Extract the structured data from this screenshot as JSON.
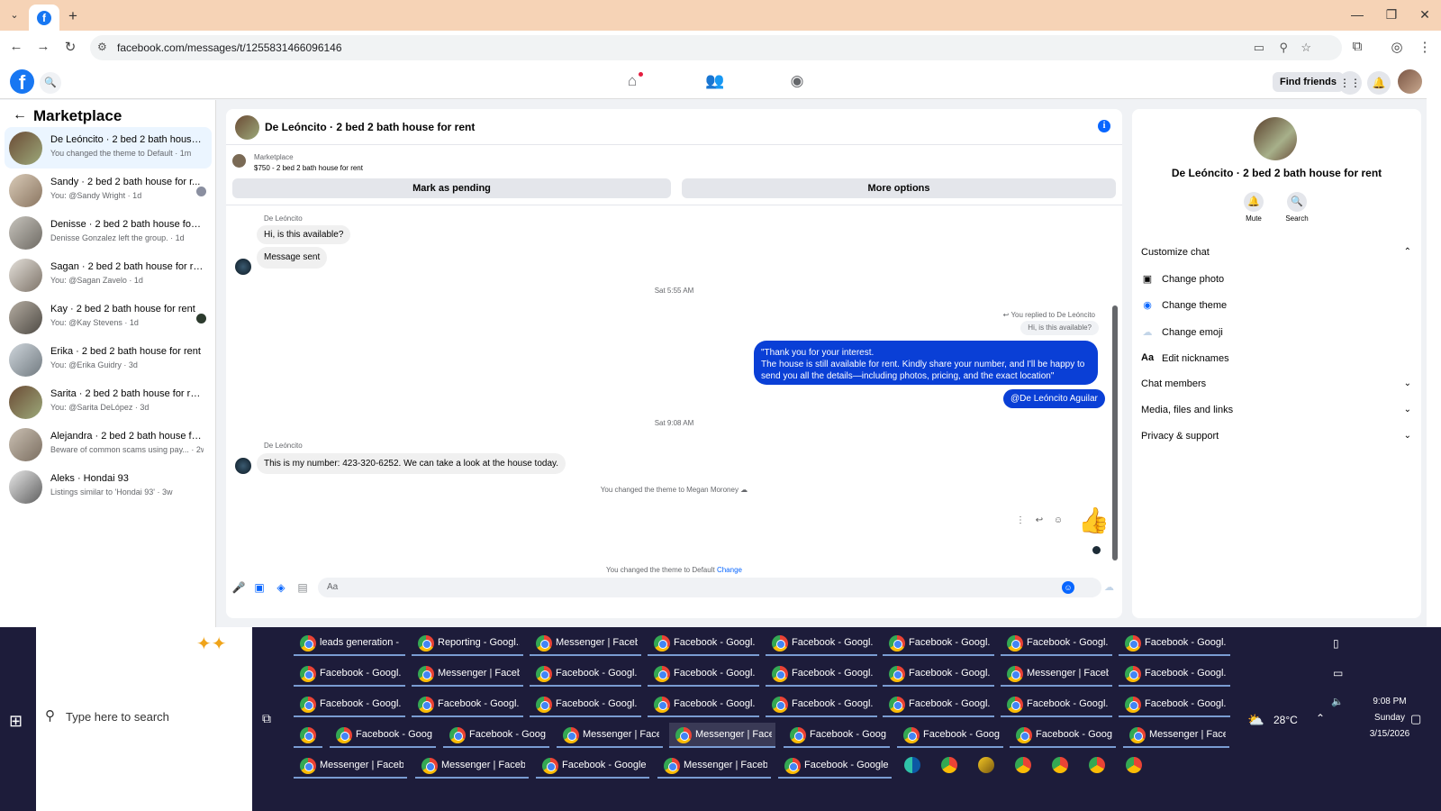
{
  "browser": {
    "url": "facebook.com/messages/t/1255831466096146",
    "newtab_symbol": "+",
    "favicon_letter": "f"
  },
  "fb_header": {
    "logo_letter": "f",
    "find_friends": "Find friends"
  },
  "sidebar": {
    "title": "Marketplace",
    "conversations": [
      {
        "name": "De Leóncito · 2 bed 2 bath house f...",
        "sub": "You changed the theme to Default · 1m",
        "active": true
      },
      {
        "name": "Sandy · 2 bed 2 bath house for r...",
        "sub": "You: @Sandy Wright · 1d"
      },
      {
        "name": "Denisse · 2 bed 2 bath house for r...",
        "sub": "Denisse Gonzalez left the group. · 1d"
      },
      {
        "name": "Sagan · 2 bed 2 bath house for rent",
        "sub": "You: @Sagan Zavelo · 1d"
      },
      {
        "name": "Kay · 2 bed 2 bath house for rent",
        "sub": "You: @Kay Stevens · 1d"
      },
      {
        "name": "Erika · 2 bed 2 bath house for rent",
        "sub": "You: @Erika Guidry · 3d"
      },
      {
        "name": "Sarita · 2 bed 2 bath house for rent",
        "sub": "You: @Sarita DeLópez · 3d"
      },
      {
        "name": "Alejandra · 2 bed 2 bath house for ...",
        "sub": "Beware of common scams using pay... · 2w"
      },
      {
        "name": "Aleks · Hondai 93",
        "sub": "Listings similar to 'Hondai 93' · 3w"
      }
    ]
  },
  "chat": {
    "title": "De Leóncito · 2 bed 2 bath house for rent",
    "marketplace_label": "Marketplace",
    "listing": "$750 - 2 bed 2 bath house for rent",
    "mark_pending": "Mark as pending",
    "more_options": "More options",
    "sender_1": "De Leóncito",
    "msg_1": "Hi, is this available?",
    "msg_2": "Message sent",
    "ts_1": "Sat 5:55 AM",
    "reply_note": "You replied to De Leóncito",
    "reply_quote": "Hi, is this available?",
    "out_lines": [
      "\"Thank you for your interest.",
      "The house is still available for rent. Kindly share your number, and I'll be happy to",
      "send you all the details—including photos, pricing, and the exact location\""
    ],
    "mention": "@De Leóncito Aguilar",
    "ts_2": "Sat 9:08 AM",
    "sender_2": "De Leóncito",
    "msg_3": "This is my number: 423-320-6252. We can take a look at the house today.",
    "sys_1": "You changed the theme to Megan Moroney",
    "sys_2_prefix": "You changed the theme to Default",
    "sys_2_link": "Change",
    "composer_placeholder": "Aa"
  },
  "info_panel": {
    "name": "De Leóncito · 2 bed 2 bath house for rent",
    "mute": "Mute",
    "search": "Search",
    "customize": "Customize chat",
    "change_photo": "Change photo",
    "change_theme": "Change theme",
    "change_emoji": "Change emoji",
    "edit_nicknames": "Edit nicknames",
    "edit_nicknames_icon": "Aa",
    "chat_members": "Chat members",
    "media": "Media, files and links",
    "privacy": "Privacy & support"
  },
  "taskbar": {
    "search_placeholder": "Type here to search",
    "row1": [
      "leads generation - ...",
      "Reporting - Googl...",
      "Messenger | Faceb...",
      "Facebook - Googl...",
      "Facebook - Googl...",
      "Facebook - Googl...",
      "Facebook - Googl...",
      "Facebook - Googl..."
    ],
    "row2": [
      "Facebook - Googl...",
      "Messenger | Faceb...",
      "Facebook - Googl...",
      "Facebook - Googl...",
      "Facebook - Googl...",
      "Facebook - Googl...",
      "Messenger | Faceb...",
      "Facebook - Googl..."
    ],
    "row3": [
      "Facebook - Googl...",
      "Facebook - Googl...",
      "Facebook - Googl...",
      "Facebook - Googl...",
      "Facebook - Googl...",
      "Facebook - Googl...",
      "Facebook - Googl...",
      "Facebook - Googl..."
    ],
    "row4": [
      "Facebook - Goog...",
      "Facebook - Goog...",
      "Messenger | Face...",
      "Messenger | Face...",
      "Facebook - Goog...",
      "Facebook - Goog...",
      "Facebook - Goog...",
      "Messenger | Face..."
    ],
    "row5": [
      "Messenger | Faceb...",
      "Messenger | Faceb...",
      "Facebook - Google ...",
      "Messenger | Faceb...",
      "Facebook - Google ..."
    ],
    "weather": "28°C",
    "time": "9:08 PM",
    "day": "Sunday",
    "date": "3/15/2026"
  },
  "colors": {
    "fb_blue": "#1877f2",
    "outgoing_bubble": "#0a3fd6",
    "taskbar": "#1d1c3a",
    "tab_bar": "#f6d3b6"
  },
  "icons": [
    "search-icon",
    "home-icon",
    "friends-icon",
    "groups-icon",
    "apps-grid-icon",
    "bell-icon",
    "info-icon",
    "mic-icon",
    "gallery-icon",
    "sticker-icon",
    "gif-icon",
    "emoji-icon",
    "like-icon",
    "reply-icon",
    "more-icon"
  ]
}
